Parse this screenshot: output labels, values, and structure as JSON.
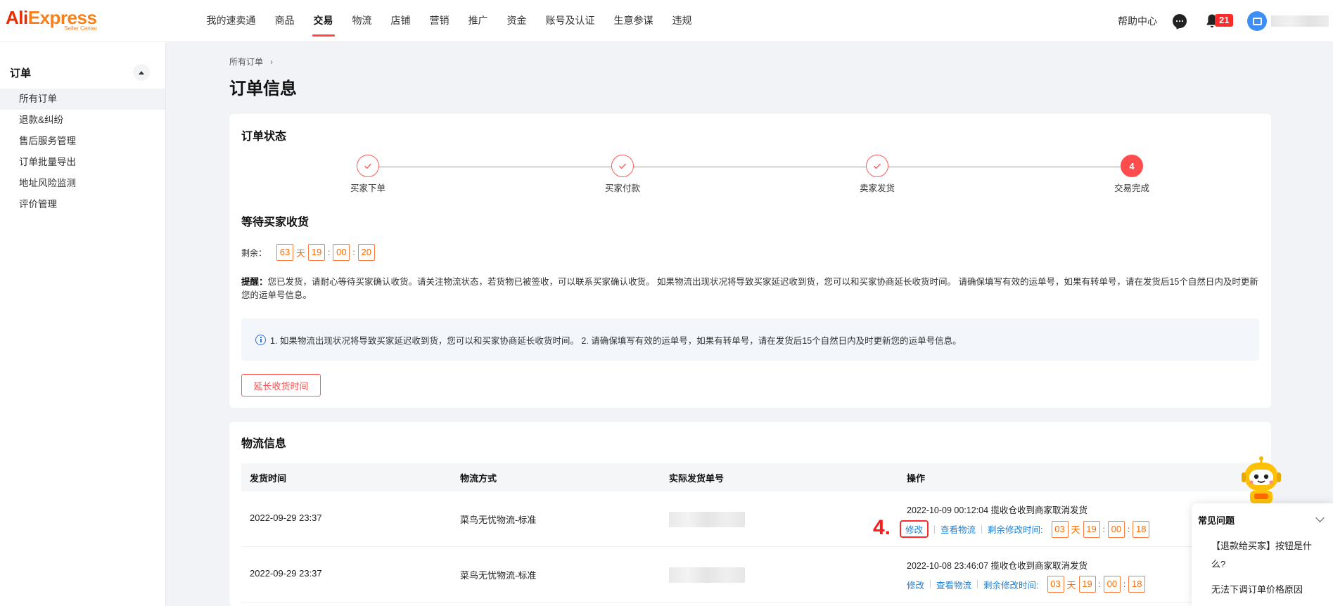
{
  "brand": {
    "name_part1": "Ali",
    "name_part2": "Express",
    "sub": "Seller Center"
  },
  "nav": {
    "items": [
      "我的速卖通",
      "商品",
      "交易",
      "物流",
      "店铺",
      "营销",
      "推广",
      "资金",
      "账号及认证",
      "生意参谋",
      "违规"
    ],
    "active": "交易"
  },
  "header": {
    "help": "帮助中心",
    "notifications": "21"
  },
  "sidebar": {
    "title": "订单",
    "items": [
      {
        "label": "所有订单",
        "active": true
      },
      {
        "label": "退款&纠纷"
      },
      {
        "label": "售后服务管理"
      },
      {
        "label": "订单批量导出"
      },
      {
        "label": "地址风险监测"
      },
      {
        "label": "评价管理"
      }
    ]
  },
  "breadcrumb": {
    "item": "所有订单",
    "sep": "›"
  },
  "page_title": "订单信息",
  "status": {
    "title": "订单状态",
    "steps": [
      {
        "label": "买家下单",
        "done": true
      },
      {
        "label": "买家付款",
        "done": true
      },
      {
        "label": "卖家发货",
        "done": true
      },
      {
        "label": "交易完成",
        "num": "4"
      }
    ],
    "wait_title": "等待买家收货",
    "remain_label": "剩余：",
    "timer": {
      "days": "63",
      "day_unit": "天",
      "hours": "19",
      "minutes": "00",
      "seconds": "20"
    },
    "reminder_label": "提醒：",
    "reminder_text": "您已发货，请耐心等待买家确认收货。请关注物流状态，若货物已被签收，可以联系买家确认收货。 如果物流出现状况将导致买家延迟收到货，您可以和买家协商延长收货时间。 请确保填写有效的运单号，如果有转单号，请在发货后15个自然日内及时更新您的运单号信息。",
    "info_text": "1. 如果物流出现状况将导致买家延迟收到货，您可以和买家协商延长收货时间。 2. 请确保填写有效的运单号，如果有转单号，请在发货后15个自然日内及时更新您的运单号信息。",
    "extend_button": "延长收货时间"
  },
  "logistics": {
    "title": "物流信息",
    "headers": [
      "发货时间",
      "物流方式",
      "实际发货单号",
      "操作"
    ],
    "rows": [
      {
        "time": "2022-09-29 23:37",
        "method": "菜鸟无忧物流-标准",
        "note": "2022-10-09 00:12:04 揽收仓收到商家取消发货",
        "edit": "修改",
        "view": "查看物流",
        "remain_label": "剩余修改时间:",
        "timer": {
          "days": "03",
          "day_unit": "天",
          "hours": "19",
          "minutes": "00",
          "seconds": "18"
        },
        "annotation": "4."
      },
      {
        "time": "2022-09-29 23:37",
        "method": "菜鸟无忧物流-标准",
        "note": "2022-10-08 23:46:07 揽收仓收到商家取消发货",
        "edit": "修改",
        "view": "查看物流",
        "remain_label": "剩余修改时间:",
        "timer": {
          "days": "03",
          "day_unit": "天",
          "hours": "19",
          "minutes": "00",
          "seconds": "18"
        }
      }
    ]
  },
  "faq": {
    "title": "常见问题",
    "q1": "【退款给买家】按钮是什么?",
    "q2": "无法下调订单价格原因"
  },
  "colors": {
    "accent": "#ff4d4d",
    "timer": "#ff6a00",
    "link": "#1a7fd8",
    "brand": "#e62e04"
  }
}
